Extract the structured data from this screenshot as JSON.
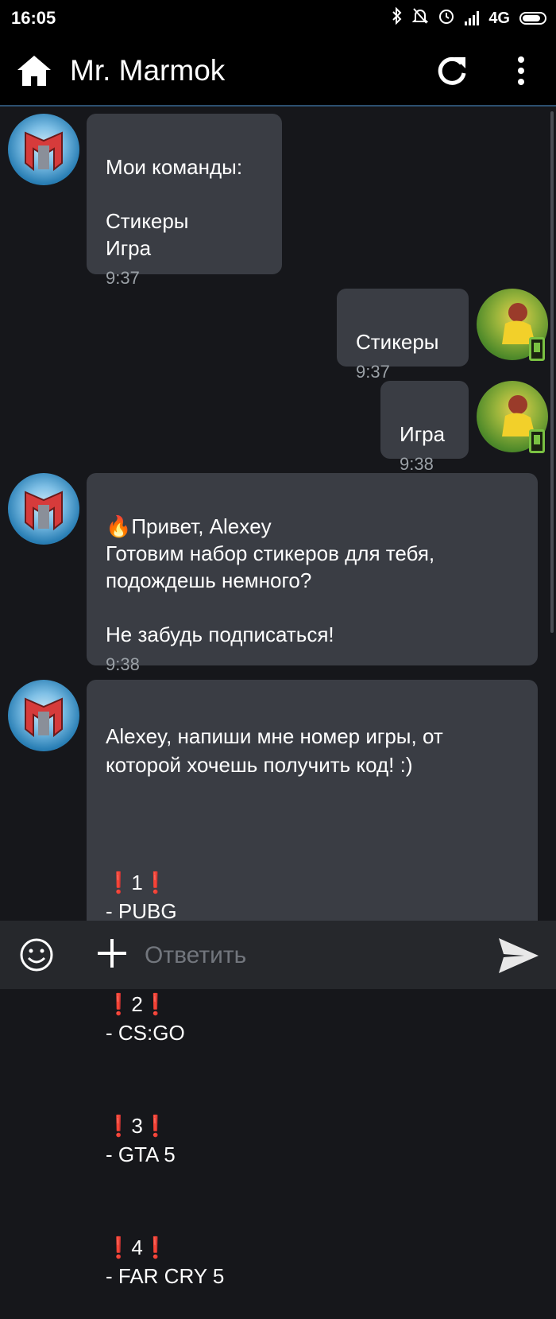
{
  "status_bar": {
    "time": "16:05",
    "network": "4G",
    "icons": [
      "bluetooth-icon",
      "bell-off-icon",
      "alarm-icon",
      "signal-icon",
      "battery-icon"
    ]
  },
  "header": {
    "title": "Mr. Marmok"
  },
  "messages": [
    {
      "side": "incoming",
      "text": "Мои команды:\n\nСтикеры\nИгра",
      "time": "9:37"
    },
    {
      "side": "outgoing",
      "text": "Стикеры",
      "time": "9:37"
    },
    {
      "side": "outgoing",
      "text": "Игра",
      "time": "9:38"
    },
    {
      "side": "incoming",
      "text": "🔥Привет, Alexey\nГотовим набор стикеров для тебя, подождешь немного?\n\nНе забудь подписаться!",
      "time": "9:38"
    },
    {
      "side": "incoming",
      "intro": "Alexey, напиши мне номер игры, от которой хочешь получить код! :)",
      "list": [
        {
          "num": "1",
          "game": "- PUBG"
        },
        {
          "num": "2",
          "game": "- CS:GO"
        },
        {
          "num": "3",
          "game": "- GTA 5"
        },
        {
          "num": "4",
          "game": "- FAR CRY 5"
        }
      ]
    }
  ],
  "composer": {
    "placeholder": "Ответить"
  },
  "colors": {
    "background": "#16171b",
    "bubble": "#3a3d44",
    "timestamp": "#9aa0a6",
    "accent_green": "#7ac142",
    "exclamation_red": "#e53935"
  }
}
